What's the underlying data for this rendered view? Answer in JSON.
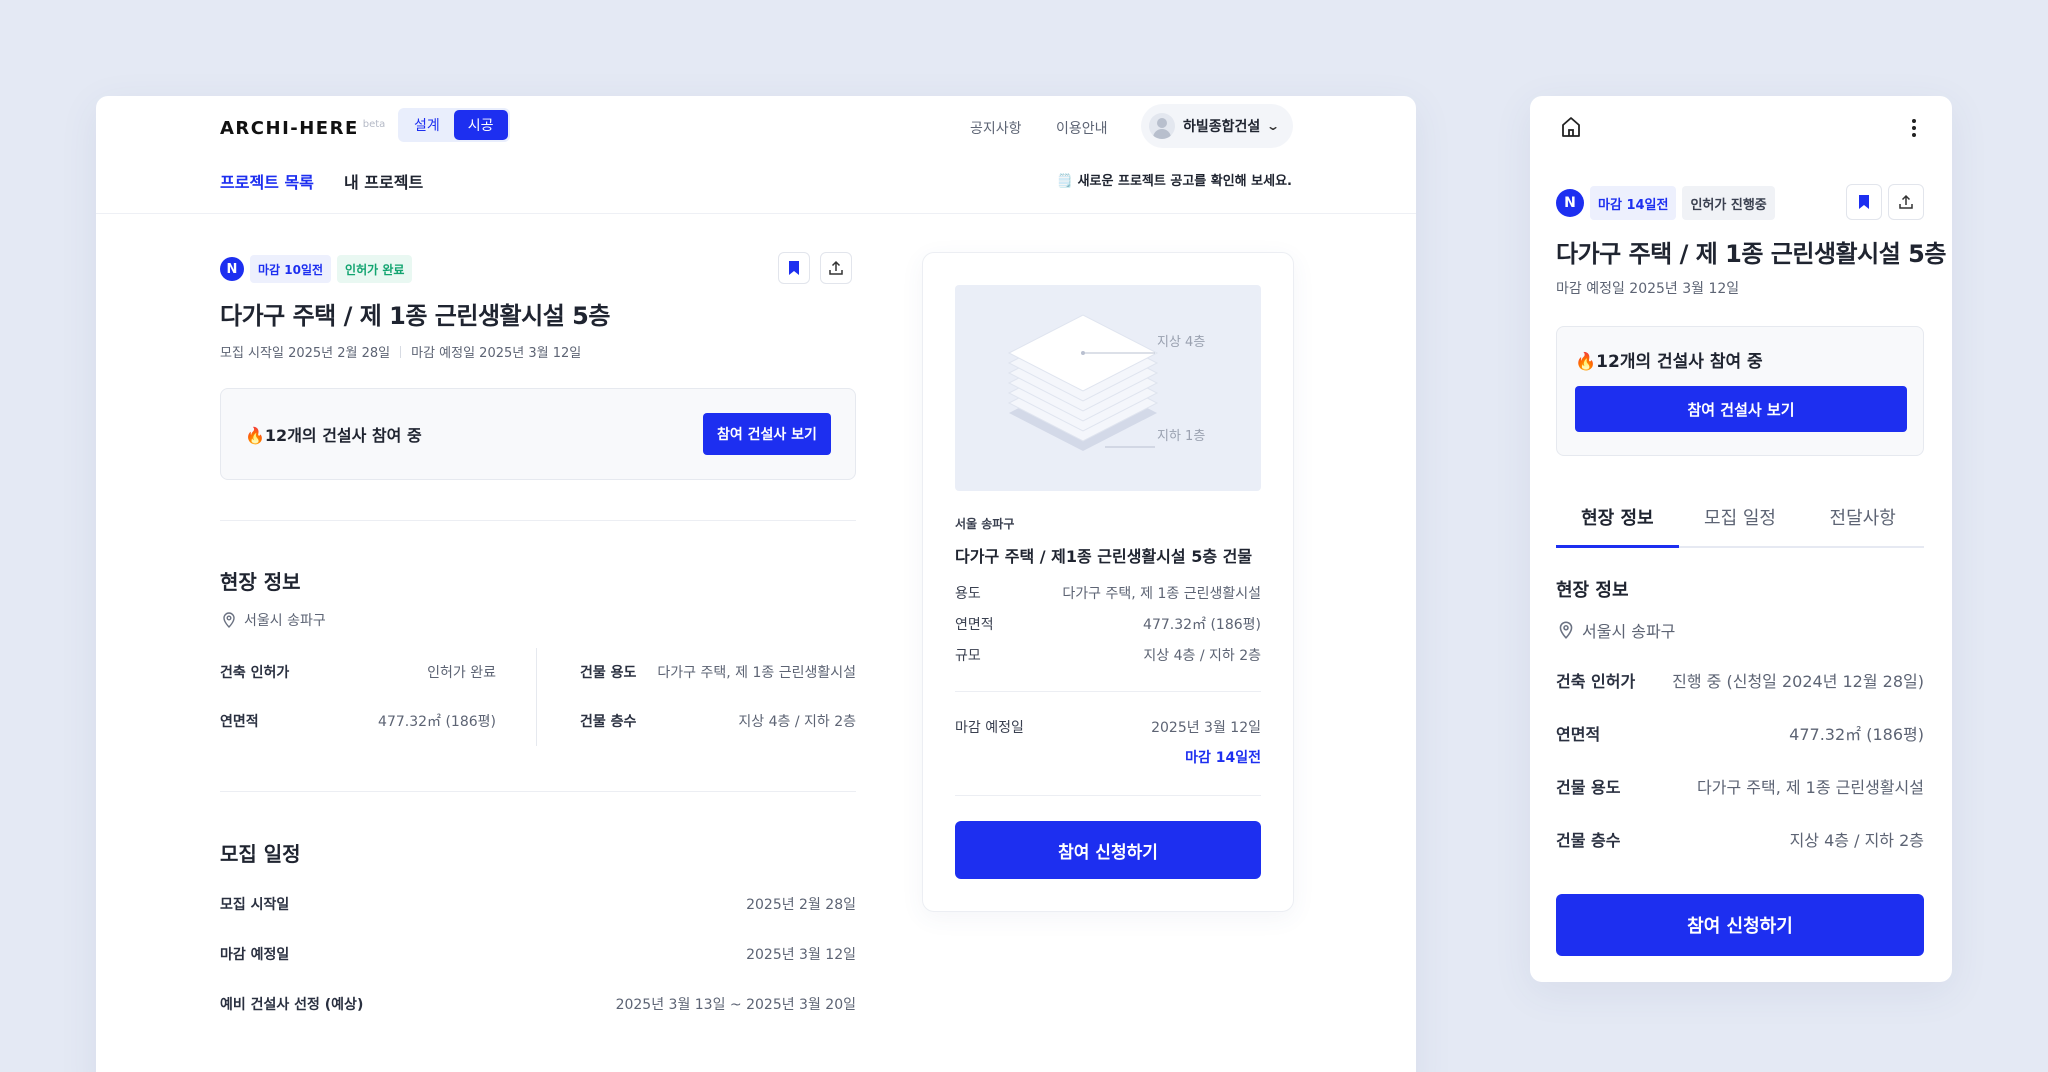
{
  "desktop": {
    "logo": {
      "name": "ARCHI-HERE",
      "tag": "beta"
    },
    "mode_toggle": [
      "설계",
      "시공"
    ],
    "topnav": [
      "공지사항",
      "이용안내"
    ],
    "company": "하빌종합건설",
    "subnav": {
      "list": "프로젝트 목록",
      "mine": "내 프로젝트"
    },
    "notice": "🗒️ 새로운 프로젝트 공고를 확인해 보세요.",
    "project": {
      "new_badge": "N",
      "deadline_chip": "마감 10일전",
      "status_chip": "인허가 완료",
      "title": "다가구 주택 / 제 1종 근린생활시설 5층",
      "meta_start": "모집 시작일  2025년 2월 28일",
      "meta_end": "마감 예정일  2025년 3월 12일",
      "participants": "🔥12개의 건설사 참여 중",
      "participants_button": "참여 건설사 보기"
    },
    "site_info": {
      "title": "현장 정보",
      "location": "서울시 송파구",
      "left": [
        {
          "k": "건축 인허가",
          "v": "인허가 완료"
        },
        {
          "k": "연면적",
          "v": "477.32㎡ (186평)"
        }
      ],
      "right": [
        {
          "k": "건물 용도",
          "v": "다가구 주택, 제 1종 근린생활시설"
        },
        {
          "k": "건물 층수",
          "v": "지상 4층 / 지하 2층"
        }
      ]
    },
    "schedule": {
      "title": "모집 일정",
      "rows": [
        {
          "k": "모집 시작일",
          "v": "2025년 2월 28일"
        },
        {
          "k": "마감 예정일",
          "v": "2025년 3월 12일"
        },
        {
          "k": "예비 건설사 선정 (예상)",
          "v": "2025년 3월 13일 ~ 2025년 3월 20일"
        }
      ]
    },
    "summary": {
      "illus_top": "지상 4층",
      "illus_bottom": "지하 1층",
      "region": "서울 송파구",
      "title": "다가구 주택 / 제1종 근린생활시설 5층 건물",
      "rows": [
        {
          "k": "용도",
          "v": "다가구 주택, 제 1종 근린생활시설"
        },
        {
          "k": "연면적",
          "v": "477.32㎡ (186평)"
        },
        {
          "k": "규모",
          "v": "지상 4층 / 지하 2층"
        }
      ],
      "deadline_label": "마감 예정일",
      "deadline_value": "2025년 3월 12일",
      "dday": "마감 14일전",
      "apply_button": "참여 신청하기"
    }
  },
  "mobile": {
    "deadline_chip": "마감 14일전",
    "status_chip": "인허가 진행중",
    "new_badge": "N",
    "title": "다가구 주택 / 제 1종 근린생활시설 5층",
    "deadline_meta": "마감 예정일  2025년 3월 12일",
    "participants": "🔥12개의 건설사 참여 중",
    "participants_button": "참여 건설사 보기",
    "tabs": [
      "현장 정보",
      "모집 일정",
      "전달사항"
    ],
    "site_title": "현장 정보",
    "location": "서울시 송파구",
    "rows": [
      {
        "k": "건축 인허가",
        "v": "진행 중 (신청일 2024년 12월 28일)"
      },
      {
        "k": "연면적",
        "v": "477.32㎡ (186평)"
      },
      {
        "k": "건물 용도",
        "v": "다가구 주택, 제 1종 근린생활시설"
      },
      {
        "k": "건물 층수",
        "v": "지상 4층 / 지하 2층"
      }
    ],
    "apply_button": "참여 신청하기"
  },
  "colors": {
    "accent": "#1d2ff0",
    "green": "#12a470",
    "background": "#e4e9f4"
  }
}
